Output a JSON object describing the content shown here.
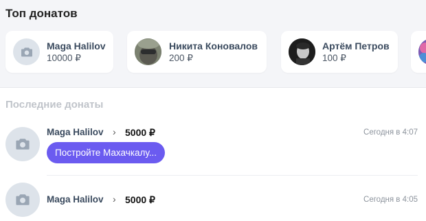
{
  "top": {
    "title": "Топ донатов",
    "cards": [
      {
        "name": "Maga Halilov",
        "amount": "10000 ₽",
        "avatar": "camera-placeholder"
      },
      {
        "name": "Никита Коновалов",
        "amount": "200 ₽",
        "avatar": "photo"
      },
      {
        "name": "Артём Петров",
        "amount": "100 ₽",
        "avatar": "photo"
      }
    ]
  },
  "recent": {
    "title": "Последние донаты",
    "items": [
      {
        "name": "Maga Halilov",
        "amount": "5000 ₽",
        "time": "Сегодня в 4:07",
        "message": "Постройте Махачкалу..."
      },
      {
        "name": "Maga Halilov",
        "amount": "5000 ₽",
        "time": "Сегодня в 4:05"
      }
    ]
  },
  "colors": {
    "accent": "#6b5bf0",
    "background_top": "#f4f5f8",
    "placeholder": "#dde3ea"
  }
}
